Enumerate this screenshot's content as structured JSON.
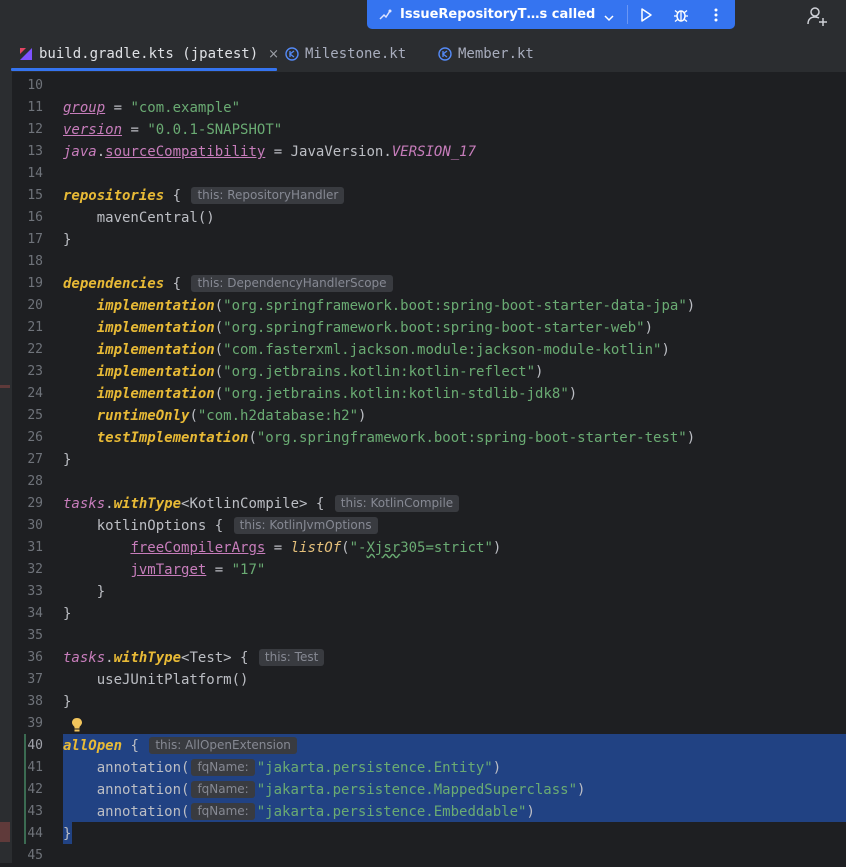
{
  "toolbar": {
    "run_config": "IssueRepositoryT…s called",
    "run_icon": "play-icon",
    "debug_icon": "bug-icon",
    "more_icon": "kebab-icon",
    "account_icon": "add-user-icon"
  },
  "tabs": [
    {
      "label": "build.gradle.kts (jpatest)",
      "active": true,
      "icon": "gradle-kotlin-icon",
      "close": "×"
    },
    {
      "label": "Milestone.kt",
      "active": false,
      "icon": "kotlin-class-icon"
    },
    {
      "label": "Member.kt",
      "active": false,
      "icon": "kotlin-class-icon"
    }
  ],
  "editor": {
    "lines": [
      "10",
      "11",
      "12",
      "13",
      "14",
      "15",
      "16",
      "17",
      "18",
      "19",
      "20",
      "21",
      "22",
      "23",
      "24",
      "25",
      "26",
      "27",
      "28",
      "29",
      "30",
      "31",
      "32",
      "33",
      "34",
      "35",
      "36",
      "37",
      "38",
      "39",
      "40",
      "41",
      "42",
      "43",
      "44",
      "45"
    ],
    "code": {
      "l11": {
        "a": "group",
        "b": " = ",
        "c": "\"com.example\""
      },
      "l12": {
        "a": "version",
        "b": " = ",
        "c": "\"0.0.1-SNAPSHOT\""
      },
      "l13": {
        "a": "java",
        "b": ".",
        "c": "sourceCompatibility",
        "d": " = JavaVersion.",
        "e": "VERSION_17"
      },
      "l15": {
        "a": "repositories",
        "b": " {",
        "hint": "this: RepositoryHandler"
      },
      "l16": {
        "a": "    mavenCentral()"
      },
      "l17": {
        "a": "}"
      },
      "l19": {
        "a": "dependencies",
        "b": " {",
        "hint": "this: DependencyHandlerScope"
      },
      "l20": {
        "a": "    ",
        "f": "implementation",
        "s": "\"org.springframework.boot:spring-boot-starter-data-jpa\""
      },
      "l21": {
        "a": "    ",
        "f": "implementation",
        "s": "\"org.springframework.boot:spring-boot-starter-web\""
      },
      "l22": {
        "a": "    ",
        "f": "implementation",
        "s": "\"com.fasterxml.jackson.module:jackson-module-kotlin\""
      },
      "l23": {
        "a": "    ",
        "f": "implementation",
        "s": "\"org.jetbrains.kotlin:kotlin-reflect\""
      },
      "l24": {
        "a": "    ",
        "f": "implementation",
        "s": "\"org.jetbrains.kotlin:kotlin-stdlib-jdk8\""
      },
      "l25": {
        "a": "    ",
        "f": "runtimeOnly",
        "s": "\"com.h2database:h2\""
      },
      "l26": {
        "a": "    ",
        "f": "testImplementation",
        "s": "\"org.springframework.boot:spring-boot-starter-test\""
      },
      "l27": {
        "a": "}"
      },
      "l29": {
        "a": "tasks",
        "b": ".",
        "c": "withType",
        "d": "<KotlinCompile> {",
        "hint": "this: KotlinCompile"
      },
      "l30": {
        "a": "    kotlinOptions {",
        "hint": "this: KotlinJvmOptions"
      },
      "l31": {
        "a": "        ",
        "p": "freeCompilerArgs",
        "b": " = ",
        "f": "listOf",
        "s1": "\"-",
        "typo": "Xjsr",
        "s2": "305=strict\"",
        "e": ")"
      },
      "l32": {
        "a": "        ",
        "p": "jvmTarget",
        "b": " = ",
        "s": "\"17\""
      },
      "l33": {
        "a": "    }"
      },
      "l34": {
        "a": "}"
      },
      "l36": {
        "a": "tasks",
        "b": ".",
        "c": "withType",
        "d": "<Test> {",
        "hint": "this: Test"
      },
      "l37": {
        "a": "    useJUnitPlatform()"
      },
      "l38": {
        "a": "}"
      },
      "l40": {
        "a": "allOpen",
        "b": " {",
        "hint": "this: AllOpenExtension"
      },
      "l41": {
        "a": "    annotation(",
        "hint": "fqName:",
        "s": "\"jakarta.persistence.Entity\"",
        "e": ")"
      },
      "l42": {
        "a": "    annotation(",
        "hint": "fqName:",
        "s": "\"jakarta.persistence.MappedSuperclass\"",
        "e": ")"
      },
      "l43": {
        "a": "    annotation(",
        "hint": "fqName:",
        "s": "\"jakarta.persistence.Embeddable\"",
        "e": ")"
      },
      "l44": {
        "a": "}"
      }
    }
  },
  "colors": {
    "accent": "#3574f0",
    "selection": "#214283",
    "string": "#6aab73",
    "function": "#e8ba36",
    "property": "#c77dbb"
  }
}
